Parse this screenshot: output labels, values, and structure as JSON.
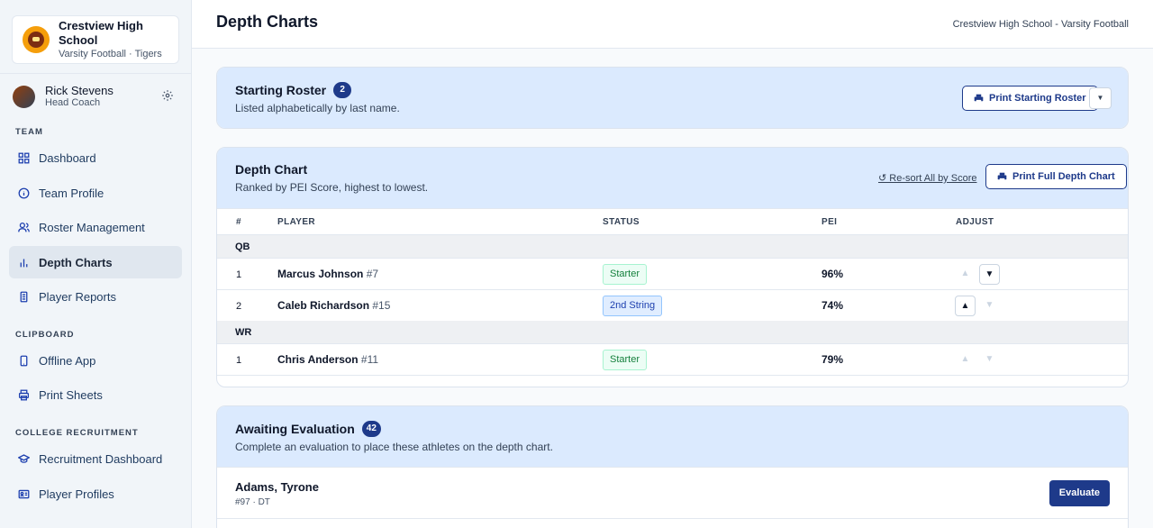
{
  "school": {
    "name": "Crestview High School",
    "subtitle": "Varsity Football · Tigers"
  },
  "user": {
    "name": "Rick Stevens",
    "role": "Head Coach"
  },
  "sidebar": {
    "sections": [
      {
        "label": "TEAM",
        "items": [
          {
            "label": "Dashboard",
            "icon": "grid-icon"
          },
          {
            "label": "Team Profile",
            "icon": "info-icon"
          },
          {
            "label": "Roster Management",
            "icon": "users-icon"
          },
          {
            "label": "Depth Charts",
            "icon": "bar-chart-icon",
            "active": true
          },
          {
            "label": "Player Reports",
            "icon": "report-icon"
          }
        ]
      },
      {
        "label": "CLIPBOARD",
        "items": [
          {
            "label": "Offline App",
            "icon": "phone-icon"
          },
          {
            "label": "Print Sheets",
            "icon": "printer-icon"
          }
        ]
      },
      {
        "label": "COLLEGE RECRUITMENT",
        "items": [
          {
            "label": "Recruitment Dashboard",
            "icon": "graduation-cap-icon"
          },
          {
            "label": "Player Profiles",
            "icon": "id-card-icon"
          }
        ]
      }
    ]
  },
  "header": {
    "title": "Depth Charts",
    "context": "Crestview High School - Varsity Football"
  },
  "starting_roster": {
    "title": "Starting Roster",
    "count": "2",
    "subtitle": "Listed alphabetically by last name.",
    "print_label": "Print Starting Roster",
    "caret": "▼"
  },
  "depth_chart": {
    "title": "Depth Chart",
    "subtitle": "Ranked by PEI Score, highest to lowest.",
    "resort_label": "↺ Re-sort All by Score",
    "print_label": "Print Full Depth Chart",
    "columns": {
      "rank": "#",
      "player": "PLAYER",
      "status": "STATUS",
      "pei": "PEI",
      "adjust": "ADJUST"
    },
    "groups": [
      {
        "position": "QB",
        "players": [
          {
            "rank": "1",
            "name": "Marcus Johnson",
            "number": "#7",
            "status": "Starter",
            "pei": "96%",
            "up_enabled": false,
            "down_enabled": true
          },
          {
            "rank": "2",
            "name": "Caleb Richardson",
            "number": "#15",
            "status": "2nd String",
            "pei": "74%",
            "up_enabled": true,
            "down_enabled": false
          }
        ]
      },
      {
        "position": "WR",
        "players": [
          {
            "rank": "1",
            "name": "Chris Anderson",
            "number": "#11",
            "status": "Starter",
            "pei": "79%",
            "up_enabled": false,
            "down_enabled": false
          }
        ]
      }
    ],
    "arrow_up": "▲",
    "arrow_down": "▼"
  },
  "awaiting": {
    "title": "Awaiting Evaluation",
    "count": "42",
    "subtitle": "Complete an evaluation to place these athletes on the depth chart.",
    "athletes": [
      {
        "name": "Adams, Tyrone",
        "meta": "#97 · DT",
        "action": "Evaluate"
      }
    ]
  },
  "colors": {
    "accent": "#1e3a8a",
    "card_header": "#dbeafe",
    "starter": "#15803d",
    "second_string": "#1e40af"
  }
}
